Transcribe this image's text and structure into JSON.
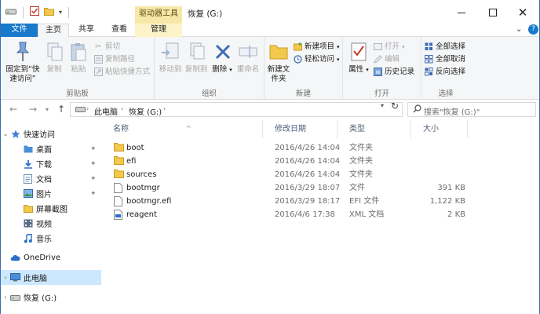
{
  "window": {
    "title": "恢复 (G:)",
    "context_tab_header": "驱动器工具"
  },
  "tabs": {
    "file": "文件",
    "home": "主页",
    "share": "共享",
    "view": "查看",
    "manage": "管理"
  },
  "ribbon": {
    "clipboard": {
      "label": "剪贴板",
      "pin": "固定到“快速访问”",
      "copy": "复制",
      "paste": "粘贴",
      "cut": "剪切",
      "copy_path": "复制路径",
      "paste_shortcut": "粘贴快捷方式"
    },
    "organize": {
      "label": "组织",
      "move_to": "移动到",
      "copy_to": "复制到",
      "delete": "删除",
      "rename": "重命名"
    },
    "new": {
      "label": "新建",
      "new_folder": "新建文件夹",
      "new_item": "新建项目",
      "easy_access": "轻松访问"
    },
    "open": {
      "label": "打开",
      "properties": "属性",
      "open": "打开",
      "edit": "编辑",
      "history": "历史记录"
    },
    "select": {
      "label": "选择",
      "select_all": "全部选择",
      "select_none": "全部取消",
      "invert": "反向选择"
    }
  },
  "address": {
    "crumbs": [
      "此电脑",
      "恢复 (G:)"
    ],
    "search_placeholder": "搜索\"恢复 (G:)\""
  },
  "nav": {
    "quick_access": "快速访问",
    "items": [
      {
        "label": "桌面",
        "icon": "desktop-icon",
        "pinned": true
      },
      {
        "label": "下载",
        "icon": "download-icon",
        "pinned": true
      },
      {
        "label": "文档",
        "icon": "documents-icon",
        "pinned": true
      },
      {
        "label": "图片",
        "icon": "pictures-icon",
        "pinned": true
      },
      {
        "label": "屏幕截图",
        "icon": "folder-icon",
        "pinned": false
      },
      {
        "label": "视频",
        "icon": "videos-icon",
        "pinned": false
      },
      {
        "label": "音乐",
        "icon": "music-icon",
        "pinned": false
      }
    ],
    "onedrive": "OneDrive",
    "this_pc": "此电脑",
    "drive": "恢复 (G:)"
  },
  "columns": {
    "name": "名称",
    "date": "修改日期",
    "type": "类型",
    "size": "大小"
  },
  "files": [
    {
      "name": "boot",
      "date": "2016/4/26 14:04",
      "type": "文件夹",
      "size": "",
      "icon": "folder"
    },
    {
      "name": "efi",
      "date": "2016/4/26 14:04",
      "type": "文件夹",
      "size": "",
      "icon": "folder"
    },
    {
      "name": "sources",
      "date": "2016/4/26 14:04",
      "type": "文件夹",
      "size": "",
      "icon": "folder"
    },
    {
      "name": "bootmgr",
      "date": "2016/3/29 18:07",
      "type": "文件",
      "size": "391 KB",
      "icon": "file"
    },
    {
      "name": "bootmgr.efi",
      "date": "2016/3/29 18:17",
      "type": "EFI 文件",
      "size": "1,122 KB",
      "icon": "file"
    },
    {
      "name": "reagent",
      "date": "2016/4/6 17:38",
      "type": "XML 文档",
      "size": "2 KB",
      "icon": "xml"
    }
  ],
  "colors": {
    "accent": "#1979ca",
    "context_tab": "#f7e8a8",
    "selected": "#cce8ff",
    "folder": "#f2c94c"
  }
}
